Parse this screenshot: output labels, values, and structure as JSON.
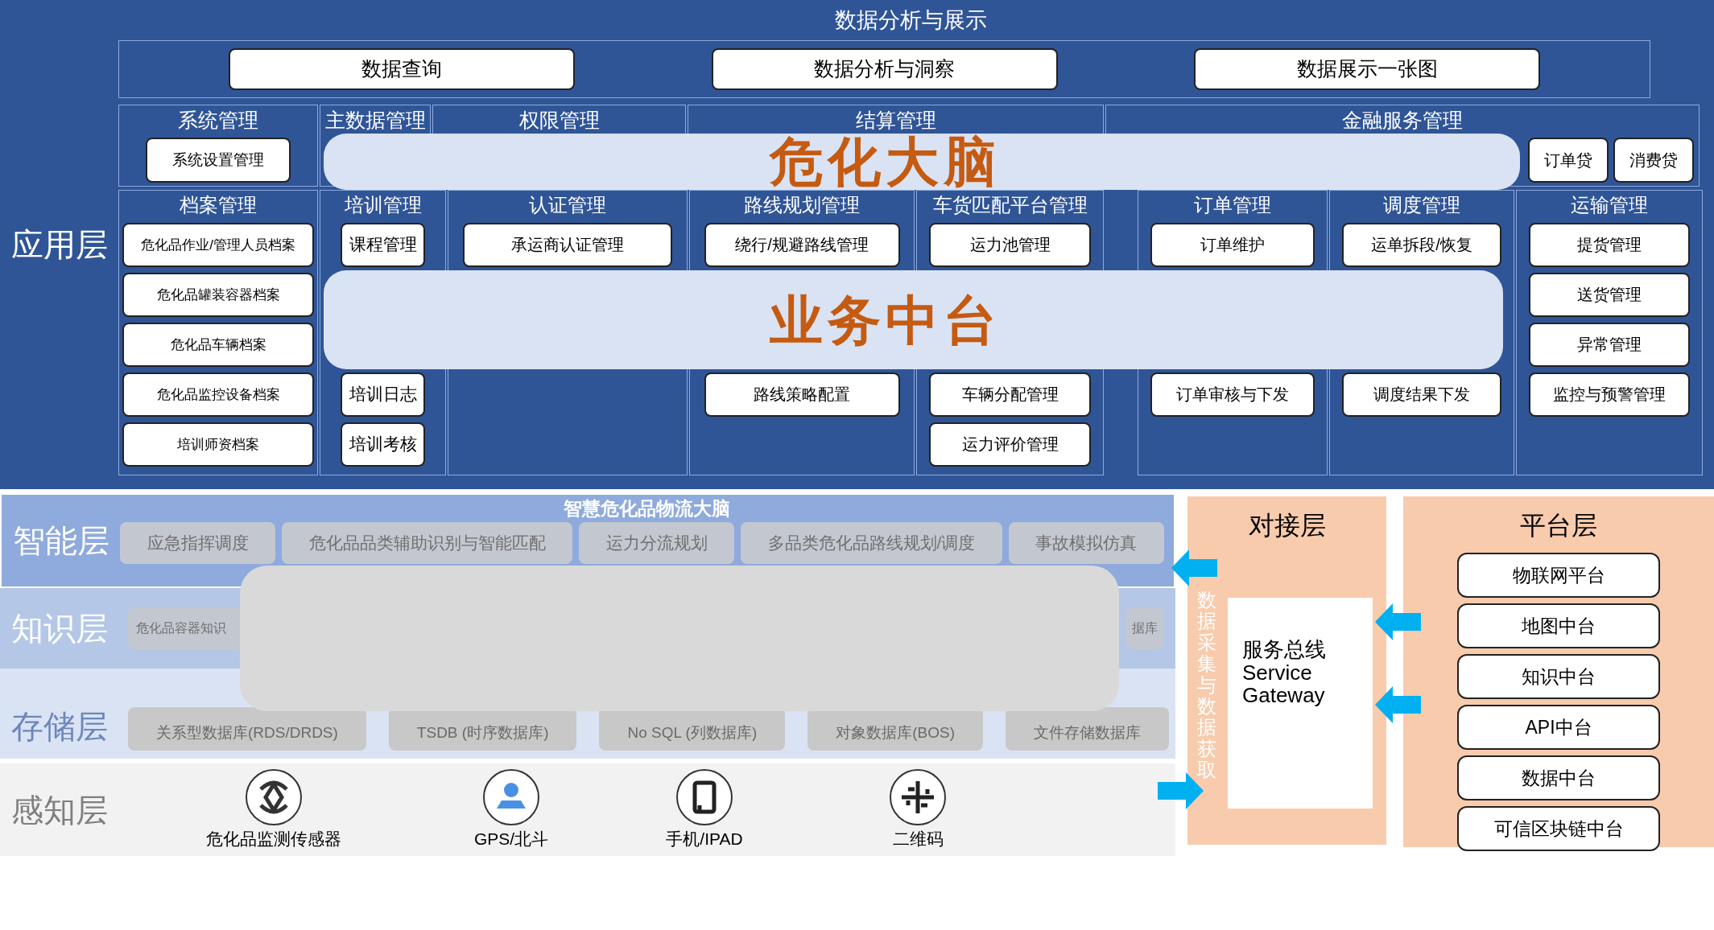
{
  "header": {
    "title": "数据分析与展示",
    "buttons": [
      "数据查询",
      "数据分析与洞察",
      "数据展示一张图"
    ]
  },
  "app_layer": {
    "label": "应用层",
    "top_groups": [
      {
        "title": "系统管理",
        "items": [
          "系统设置管理"
        ]
      },
      {
        "title": "主数据管理"
      },
      {
        "title": "权限管理"
      },
      {
        "title": "结算管理"
      },
      {
        "title": "金融服务管理",
        "items": [
          "订单贷",
          "消费贷"
        ]
      }
    ],
    "groups": [
      {
        "title": "档案管理",
        "items": [
          "危化品作业/管理人员档案",
          "危化品罐装容器档案",
          "危化品车辆档案",
          "危化品监控设备档案",
          "培训师资档案"
        ]
      },
      {
        "title": "培训管理",
        "items": [
          "课程管理",
          "培训日志",
          "培训考核"
        ]
      },
      {
        "title": "认证管理",
        "items": [
          "承运商认证管理"
        ]
      },
      {
        "title": "路线规划管理",
        "items": [
          "绕行/规避路线管理",
          "路线策略配置"
        ]
      },
      {
        "title": "车货匹配平台管理",
        "items": [
          "运力池管理",
          "车辆分配管理",
          "运力评价管理"
        ]
      },
      {
        "title": "订单管理",
        "items": [
          "订单维护",
          "订单审核与下发"
        ]
      },
      {
        "title": "调度管理",
        "items": [
          "运单拆段/恢复",
          "调度结果下发"
        ]
      },
      {
        "title": "运输管理",
        "items": [
          "提货管理",
          "送货管理",
          "异常管理",
          "监控与预警管理"
        ]
      }
    ]
  },
  "overlays": [
    "危化大脑",
    "业务中台"
  ],
  "intelligence_layer": {
    "label": "智能层",
    "title": "智慧危化品物流大脑",
    "items": [
      "应急指挥调度",
      "危化品品类辅助识别与智能匹配",
      "运力分流规划",
      "多品类危化品路线规划/调度",
      "事故模拟仿真"
    ]
  },
  "knowledge_layer": {
    "label": "知识层",
    "items": [
      "危化品容器知识",
      "据库"
    ]
  },
  "storage_layer": {
    "label": "存储层",
    "items": [
      "关系型数据库(RDS/DRDS)",
      "TSDB (时序数据库)",
      "No SQL (列数据库)",
      "对象数据库(BOS)",
      "文件存储数据库"
    ]
  },
  "perception_layer": {
    "label": "感知层",
    "devices": [
      "危化品监测传感器",
      "GPS/北斗",
      "手机/IPAD",
      "二维码"
    ]
  },
  "docking_layer": {
    "title": "对接层",
    "side_text": "数据采集与数据获取",
    "gateway": "服务总线\nService\nGateway"
  },
  "platform_layer": {
    "title": "平台层",
    "items": [
      "物联网平台",
      "地图中台",
      "知识中台",
      "API中台",
      "数据中台",
      "可信区块链中台"
    ]
  }
}
